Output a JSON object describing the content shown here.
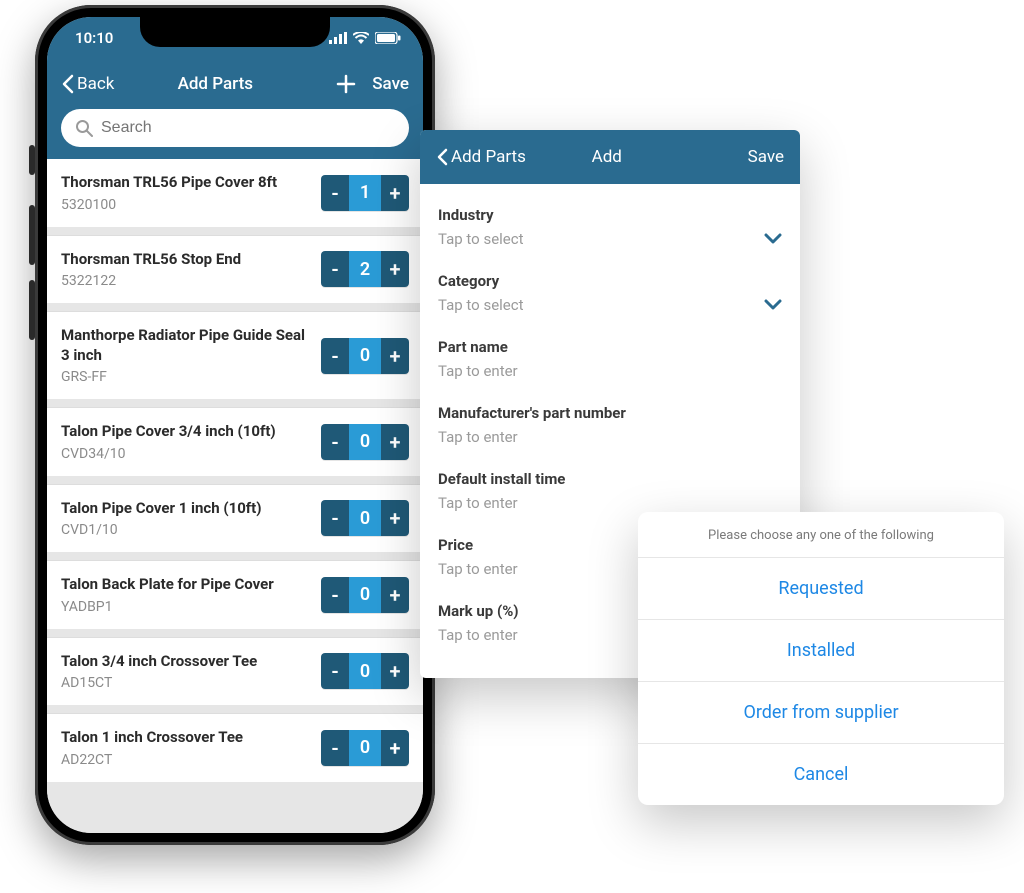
{
  "status": {
    "time": "10:10"
  },
  "nav": {
    "back_label": "Back",
    "title": "Add Parts",
    "save_label": "Save"
  },
  "search": {
    "placeholder": "Search"
  },
  "parts": [
    {
      "name": "Thorsman TRL56 Pipe Cover 8ft",
      "sku": "5320100",
      "qty": "1"
    },
    {
      "name": "Thorsman TRL56 Stop End",
      "sku": "5322122",
      "qty": "2"
    },
    {
      "name": "Manthorpe Radiator Pipe Guide Seal 3 inch",
      "sku": "GRS-FF",
      "qty": "0"
    },
    {
      "name": "Talon Pipe Cover 3/4 inch (10ft)",
      "sku": "CVD34/10",
      "qty": "0"
    },
    {
      "name": "Talon Pipe Cover 1 inch (10ft)",
      "sku": "CVD1/10",
      "qty": "0"
    },
    {
      "name": "Talon Back Plate for Pipe Cover",
      "sku": "YADBP1",
      "qty": "0"
    },
    {
      "name": "Talon 3/4 inch Crossover Tee",
      "sku": "AD15CT",
      "qty": "0"
    },
    {
      "name": "Talon 1 inch Crossover Tee",
      "sku": "AD22CT",
      "qty": "0"
    }
  ],
  "add_panel": {
    "back_label": "Add Parts",
    "title": "Add",
    "save_label": "Save",
    "fields": {
      "industry": {
        "label": "Industry",
        "value": "Tap to select"
      },
      "category": {
        "label": "Category",
        "value": "Tap to select"
      },
      "part_name": {
        "label": "Part name",
        "value": "Tap to enter"
      },
      "mpn": {
        "label": "Manufacturer's part number",
        "value": "Tap to enter"
      },
      "install": {
        "label": "Default install time",
        "value": "Tap to enter"
      },
      "price": {
        "label": "Price",
        "value": "Tap to enter"
      },
      "markup": {
        "label": "Mark up (%)",
        "value": "Tap to enter"
      }
    }
  },
  "action_sheet": {
    "title": "Please choose any one of the following",
    "options": {
      "requested": "Requested",
      "installed": "Installed",
      "order": "Order from supplier",
      "cancel": "Cancel"
    }
  }
}
